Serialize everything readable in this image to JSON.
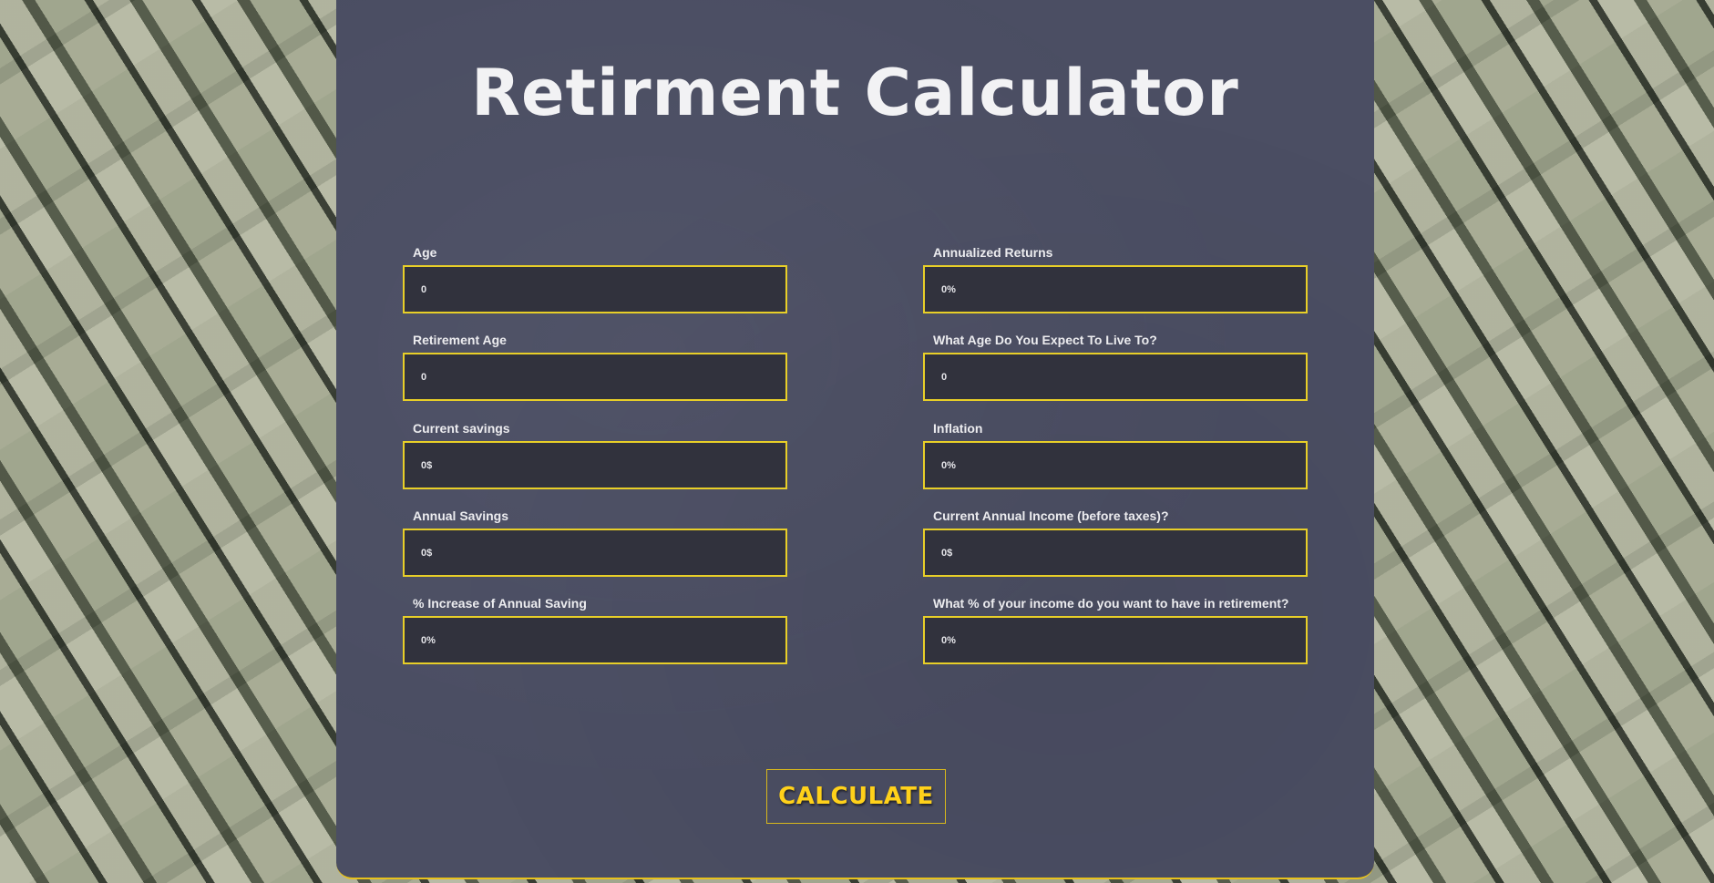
{
  "page": {
    "title": "Retirment Calculator"
  },
  "form": {
    "left": [
      {
        "label": "Age",
        "placeholder": "0"
      },
      {
        "label": "Retirement Age",
        "placeholder": "0"
      },
      {
        "label": "Current savings",
        "placeholder": "0$"
      },
      {
        "label": "Annual Savings",
        "placeholder": "0$"
      },
      {
        "label": "% Increase of Annual Saving",
        "placeholder": "0%"
      }
    ],
    "right": [
      {
        "label": "Annualized Returns",
        "placeholder": "0%"
      },
      {
        "label": "What Age Do You Expect To Live To?",
        "placeholder": "0"
      },
      {
        "label": "Inflation",
        "placeholder": "0%"
      },
      {
        "label": "Current Annual Income (before taxes)?",
        "placeholder": "0$"
      },
      {
        "label": "What % of your income do you want to have in retirement?",
        "placeholder": "0%"
      }
    ]
  },
  "actions": {
    "calculate_label": "CALCULATE"
  },
  "colors": {
    "accent": "#e8cf28",
    "button_text": "#ffd11a",
    "card_bg": "#4b4e63",
    "input_bg": "#31323d"
  }
}
